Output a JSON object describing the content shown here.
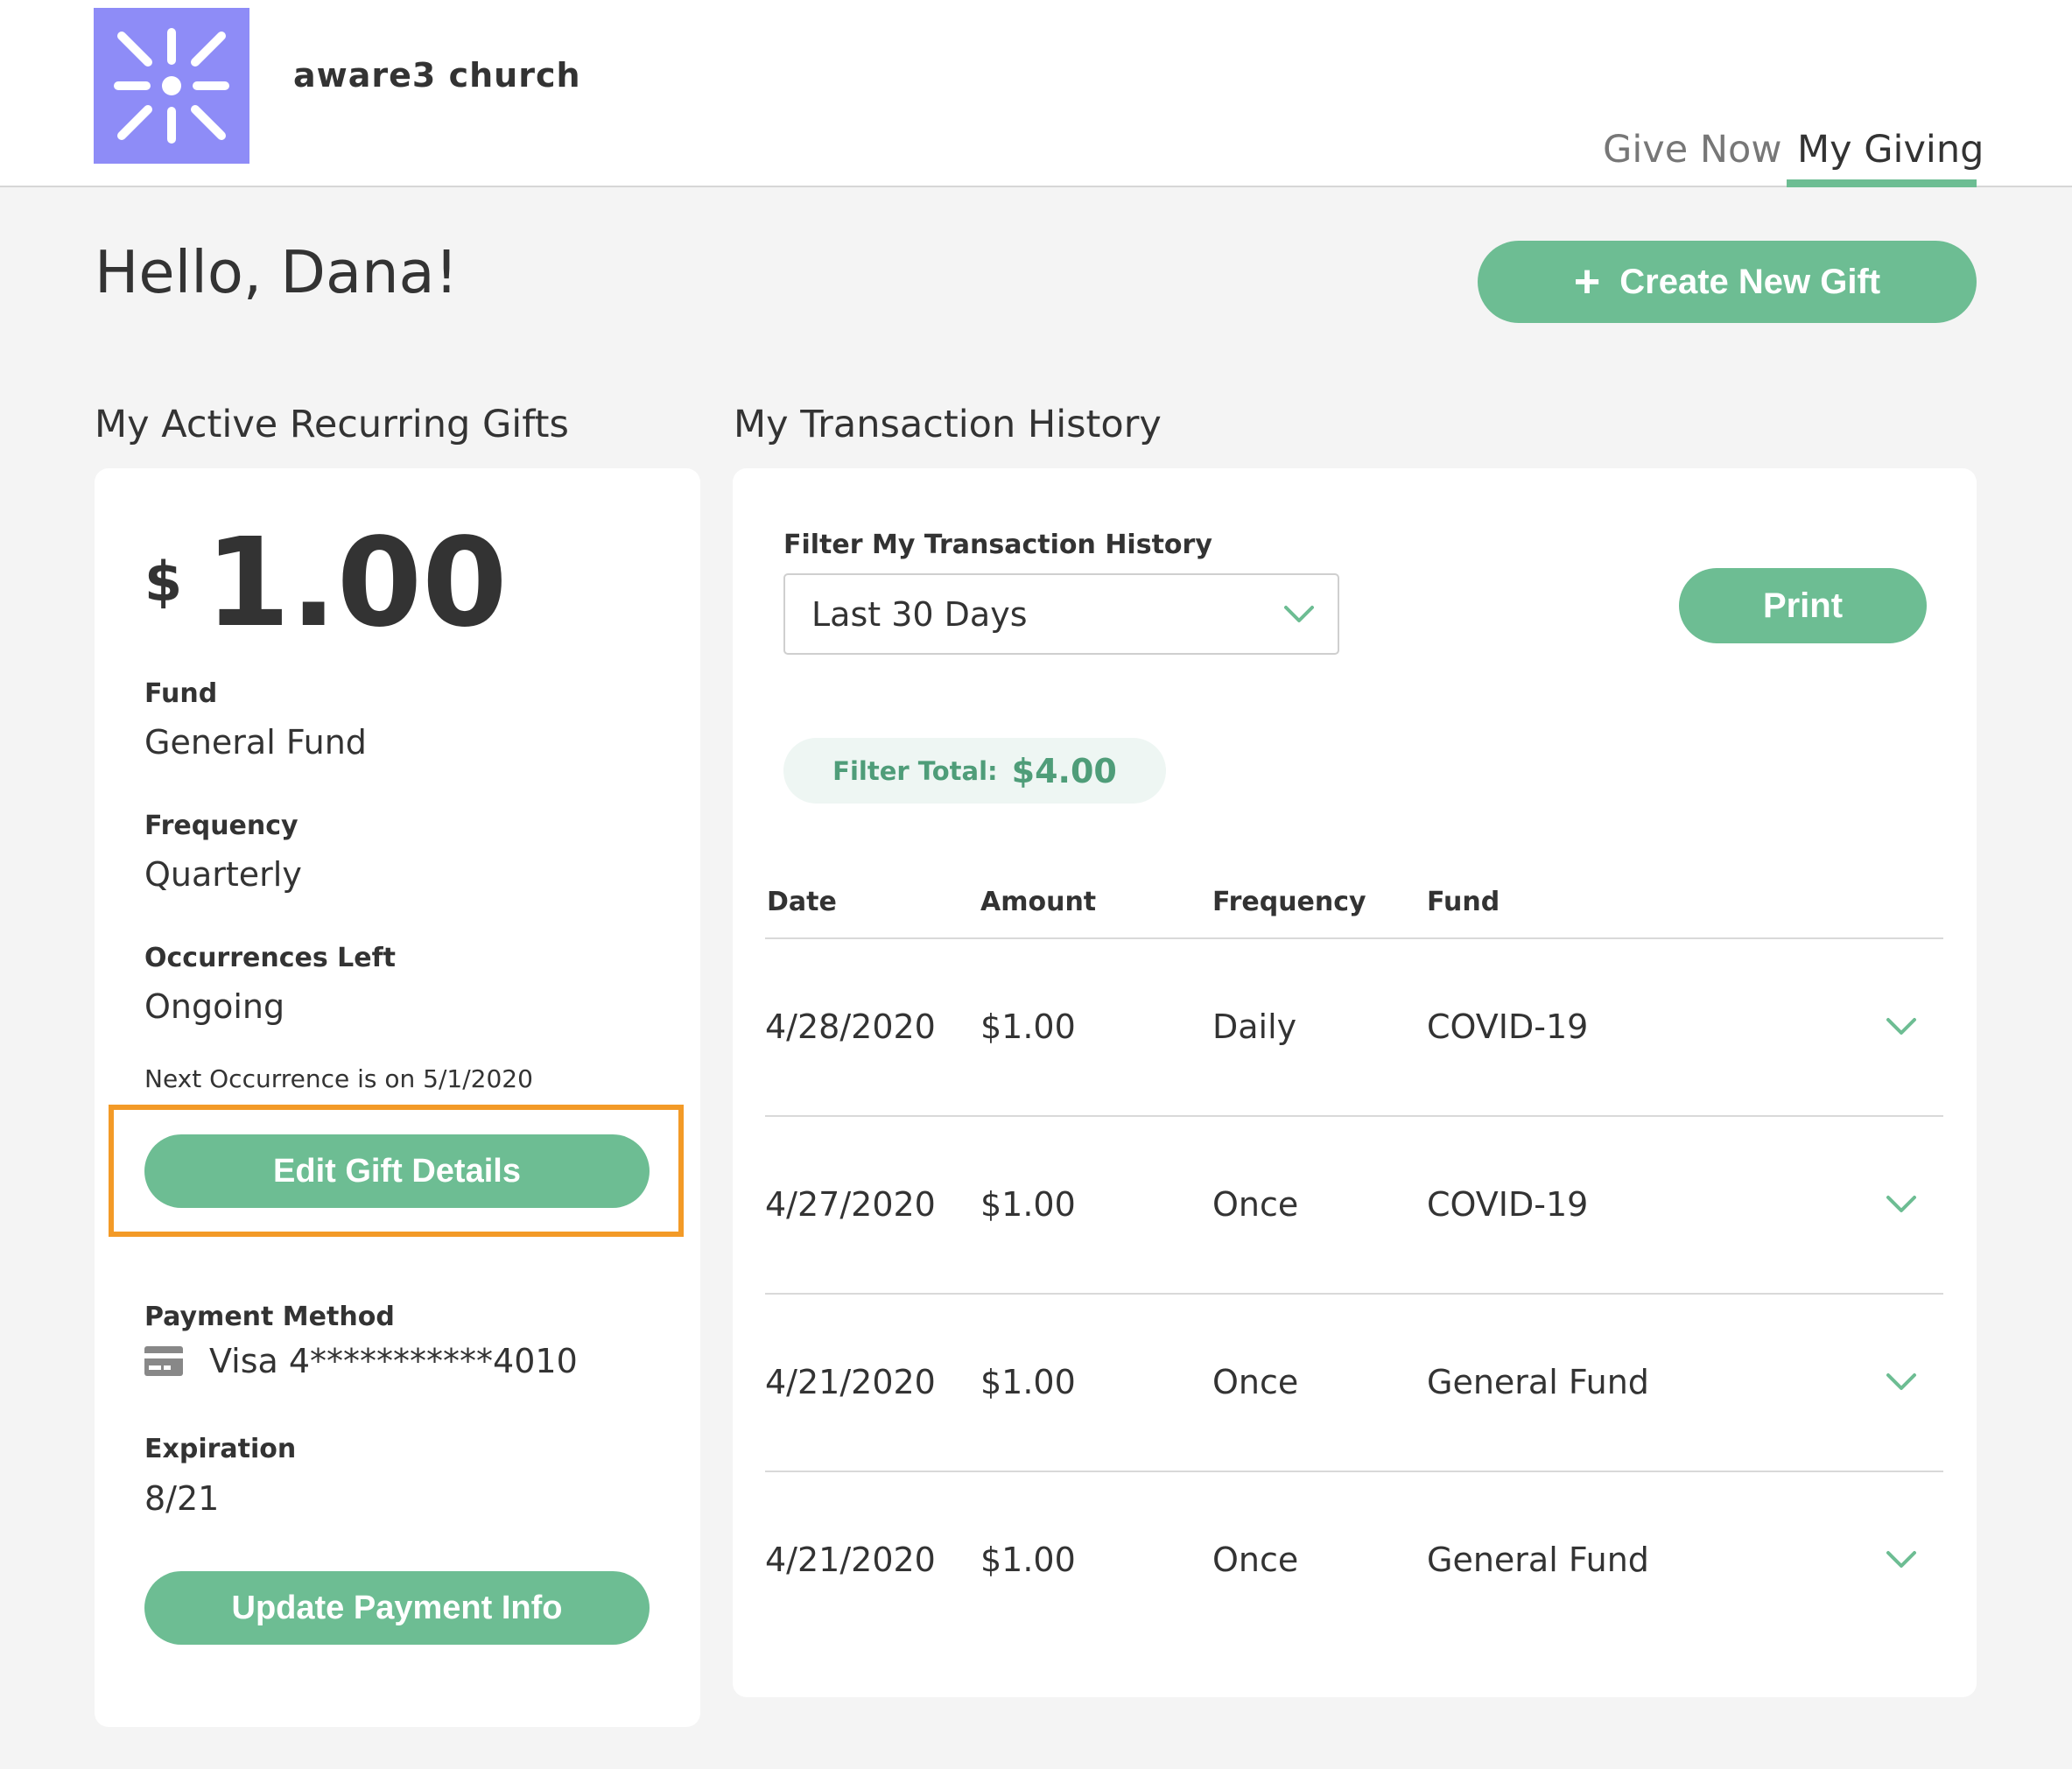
{
  "header": {
    "org_name": "aware3 church",
    "nav": [
      {
        "label": "Give Now",
        "active": false
      },
      {
        "label": "My Giving",
        "active": true
      }
    ],
    "accent_color": "#6dbd93",
    "logo_color": "#8e8cf7"
  },
  "greeting": "Hello, Dana!",
  "create_button": "Create New Gift",
  "recurring": {
    "section_title": "My Active Recurring Gifts",
    "currency": "$",
    "amount": "1.00",
    "fund_label": "Fund",
    "fund_value": "General Fund",
    "frequency_label": "Frequency",
    "frequency_value": "Quarterly",
    "occurrences_label": "Occurrences Left",
    "occurrences_value": "Ongoing",
    "next_occurrence": "Next Occurrence is on 5/1/2020",
    "edit_button": "Edit Gift Details",
    "payment_label": "Payment Method",
    "payment_value": "Visa 4***********4010",
    "expiration_label": "Expiration",
    "expiration_value": "8/21",
    "update_button": "Update Payment Info",
    "highlight_color": "#f39a27"
  },
  "history": {
    "section_title": "My Transaction History",
    "filter_label": "Filter My Transaction History",
    "filter_value": "Last 30 Days",
    "print_button": "Print",
    "filter_total_label": "Filter Total:",
    "filter_total_value": "$4.00",
    "columns": [
      "Date",
      "Amount",
      "Frequency",
      "Fund"
    ],
    "rows": [
      {
        "date": "4/28/2020",
        "amount": "$1.00",
        "frequency": "Daily",
        "fund": "COVID-19"
      },
      {
        "date": "4/27/2020",
        "amount": "$1.00",
        "frequency": "Once",
        "fund": "COVID-19"
      },
      {
        "date": "4/21/2020",
        "amount": "$1.00",
        "frequency": "Once",
        "fund": "General Fund"
      },
      {
        "date": "4/21/2020",
        "amount": "$1.00",
        "frequency": "Once",
        "fund": "General Fund"
      }
    ]
  }
}
